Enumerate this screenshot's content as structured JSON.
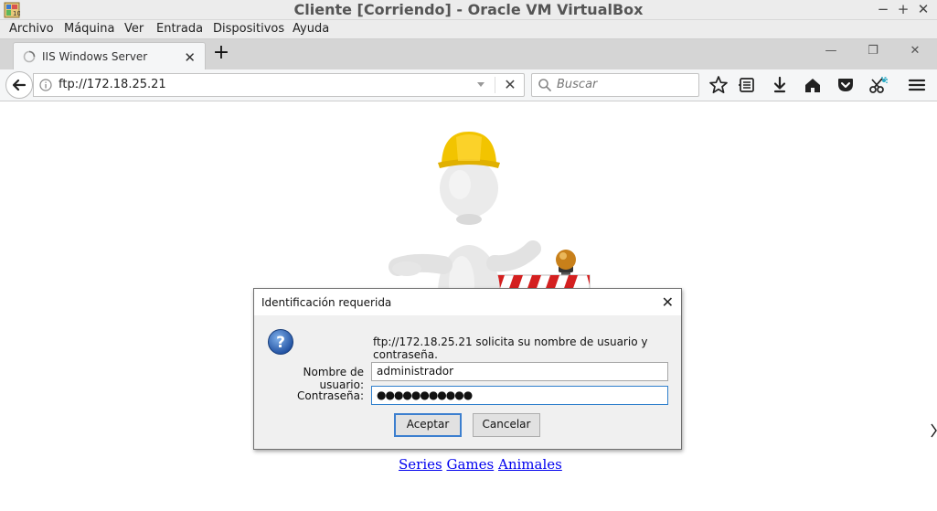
{
  "vbox": {
    "title": "Cliente [Corriendo] - Oracle VM VirtualBox",
    "controls": {
      "minimize": "−",
      "maximize": "+",
      "close": "✕"
    },
    "menu": [
      "Archivo",
      "Máquina",
      "Ver",
      "Entrada",
      "Dispositivos",
      "Ayuda"
    ]
  },
  "browser": {
    "tab_title": "IIS Windows Server",
    "tab_close": "✕",
    "new_tab": "+",
    "window_controls": {
      "minimize": "—",
      "restore": "❐",
      "close": "✕"
    },
    "url": "ftp://172.18.25.21",
    "search_placeholder": "Buscar",
    "stop": "✕"
  },
  "page": {
    "links": [
      "Series",
      "Games",
      "Animales"
    ]
  },
  "auth_dialog": {
    "title": "Identificación requerida",
    "close": "✕",
    "message": "ftp://172.18.25.21 solicita su nombre de usuario y contraseña.",
    "username_label": "Nombre de usuario:",
    "username_value": "administrador",
    "password_label": "Contraseña:",
    "password_value": "●●●●●●●●●●●",
    "accept_label": "Aceptar",
    "cancel_label": "Cancelar"
  },
  "colors": {
    "link": "#0000ee",
    "focus": "#3c7fcf",
    "helmet": "#f2c400",
    "barrier_red": "#d42020"
  }
}
